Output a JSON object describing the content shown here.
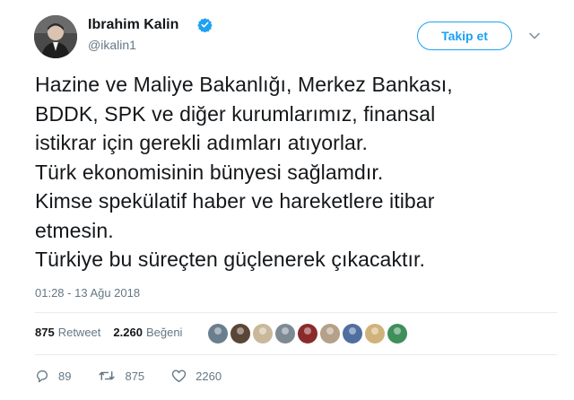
{
  "header": {
    "display_name": "Ibrahim Kalin",
    "username": "@ikalin1",
    "follow_label": "Takip et",
    "accent": "#1da1f2"
  },
  "tweet": {
    "lines": [
      "Hazine ve Maliye Bakanlığı, Merkez Bankası,",
      "BDDK, SPK ve diğer kurumlarımız, finansal",
      "istikrar için gerekli adımları atıyorlar.",
      "Türk ekonomisinin bünyesi sağlamdır.",
      "Kimse spekülatif haber ve hareketlere itibar",
      "etmesin.",
      "Türkiye bu süreçten güçlenerek çıkacaktır."
    ],
    "timestamp": "01:28 - 13 Ağu 2018"
  },
  "stats": {
    "retweet_count": "875",
    "retweet_label": "Retweet",
    "like_count": "2.260",
    "like_label": "Beğeni",
    "faces": [
      "#6a7f8e",
      "#5a4636",
      "#c9b89a",
      "#7d8a94",
      "#8a2b2b",
      "#b5a089",
      "#4f6fa0",
      "#d1b27a",
      "#3f8f5a"
    ]
  },
  "actions": {
    "reply_count": "89",
    "retweet_count": "875",
    "like_count": "2260"
  }
}
